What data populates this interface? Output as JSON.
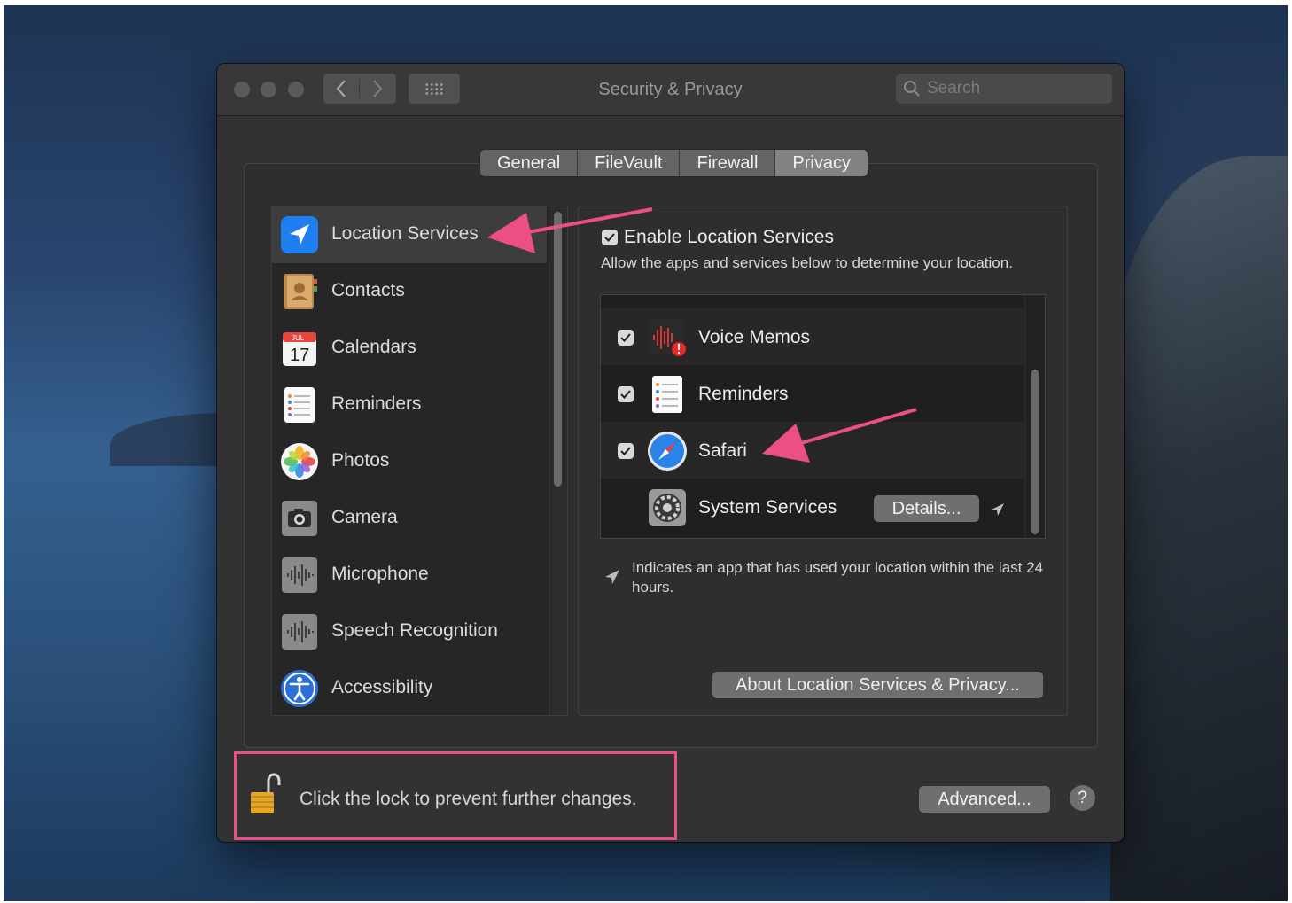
{
  "window": {
    "title": "Security & Privacy",
    "nav_back": "‹",
    "nav_forward": "›",
    "search_placeholder": "Search"
  },
  "tabs": [
    {
      "label": "General",
      "active": false
    },
    {
      "label": "FileVault",
      "active": false
    },
    {
      "label": "Firewall",
      "active": false
    },
    {
      "label": "Privacy",
      "active": true
    }
  ],
  "sidebar": {
    "items": [
      {
        "label": "Location Services",
        "icon": "location-arrow-icon",
        "selected": true
      },
      {
        "label": "Contacts",
        "icon": "contacts-book-icon"
      },
      {
        "label": "Calendars",
        "icon": "calendar-icon",
        "icon_month": "JUL",
        "icon_day": "17"
      },
      {
        "label": "Reminders",
        "icon": "reminders-list-icon"
      },
      {
        "label": "Photos",
        "icon": "photos-flower-icon"
      },
      {
        "label": "Camera",
        "icon": "camera-icon"
      },
      {
        "label": "Microphone",
        "icon": "microphone-waveform-icon"
      },
      {
        "label": "Speech Recognition",
        "icon": "speech-waveform-icon"
      },
      {
        "label": "Accessibility",
        "icon": "accessibility-person-icon"
      }
    ]
  },
  "location": {
    "enable_label": "Enable Location Services",
    "enable_checked": true,
    "description": "Allow the apps and services below to determine your location.",
    "apps": [
      {
        "label": "Voice Memos",
        "checked": true,
        "icon": "voice-memos-icon"
      },
      {
        "label": "Reminders",
        "checked": true,
        "icon": "reminders-list-icon"
      },
      {
        "label": "Safari",
        "checked": true,
        "icon": "safari-compass-icon"
      },
      {
        "label": "System Services",
        "icon": "system-gear-icon"
      }
    ],
    "details_button": "Details...",
    "legend_text": "Indicates an app that has used your location within the last 24 hours.",
    "about_button": "About Location Services & Privacy..."
  },
  "footer": {
    "lock_text": "Click the lock to prevent further changes.",
    "advanced_button": "Advanced...",
    "help_button": "?"
  },
  "colors": {
    "annotation": "#ec4e86",
    "window_bg": "#323232",
    "list_bg": "#262626"
  }
}
